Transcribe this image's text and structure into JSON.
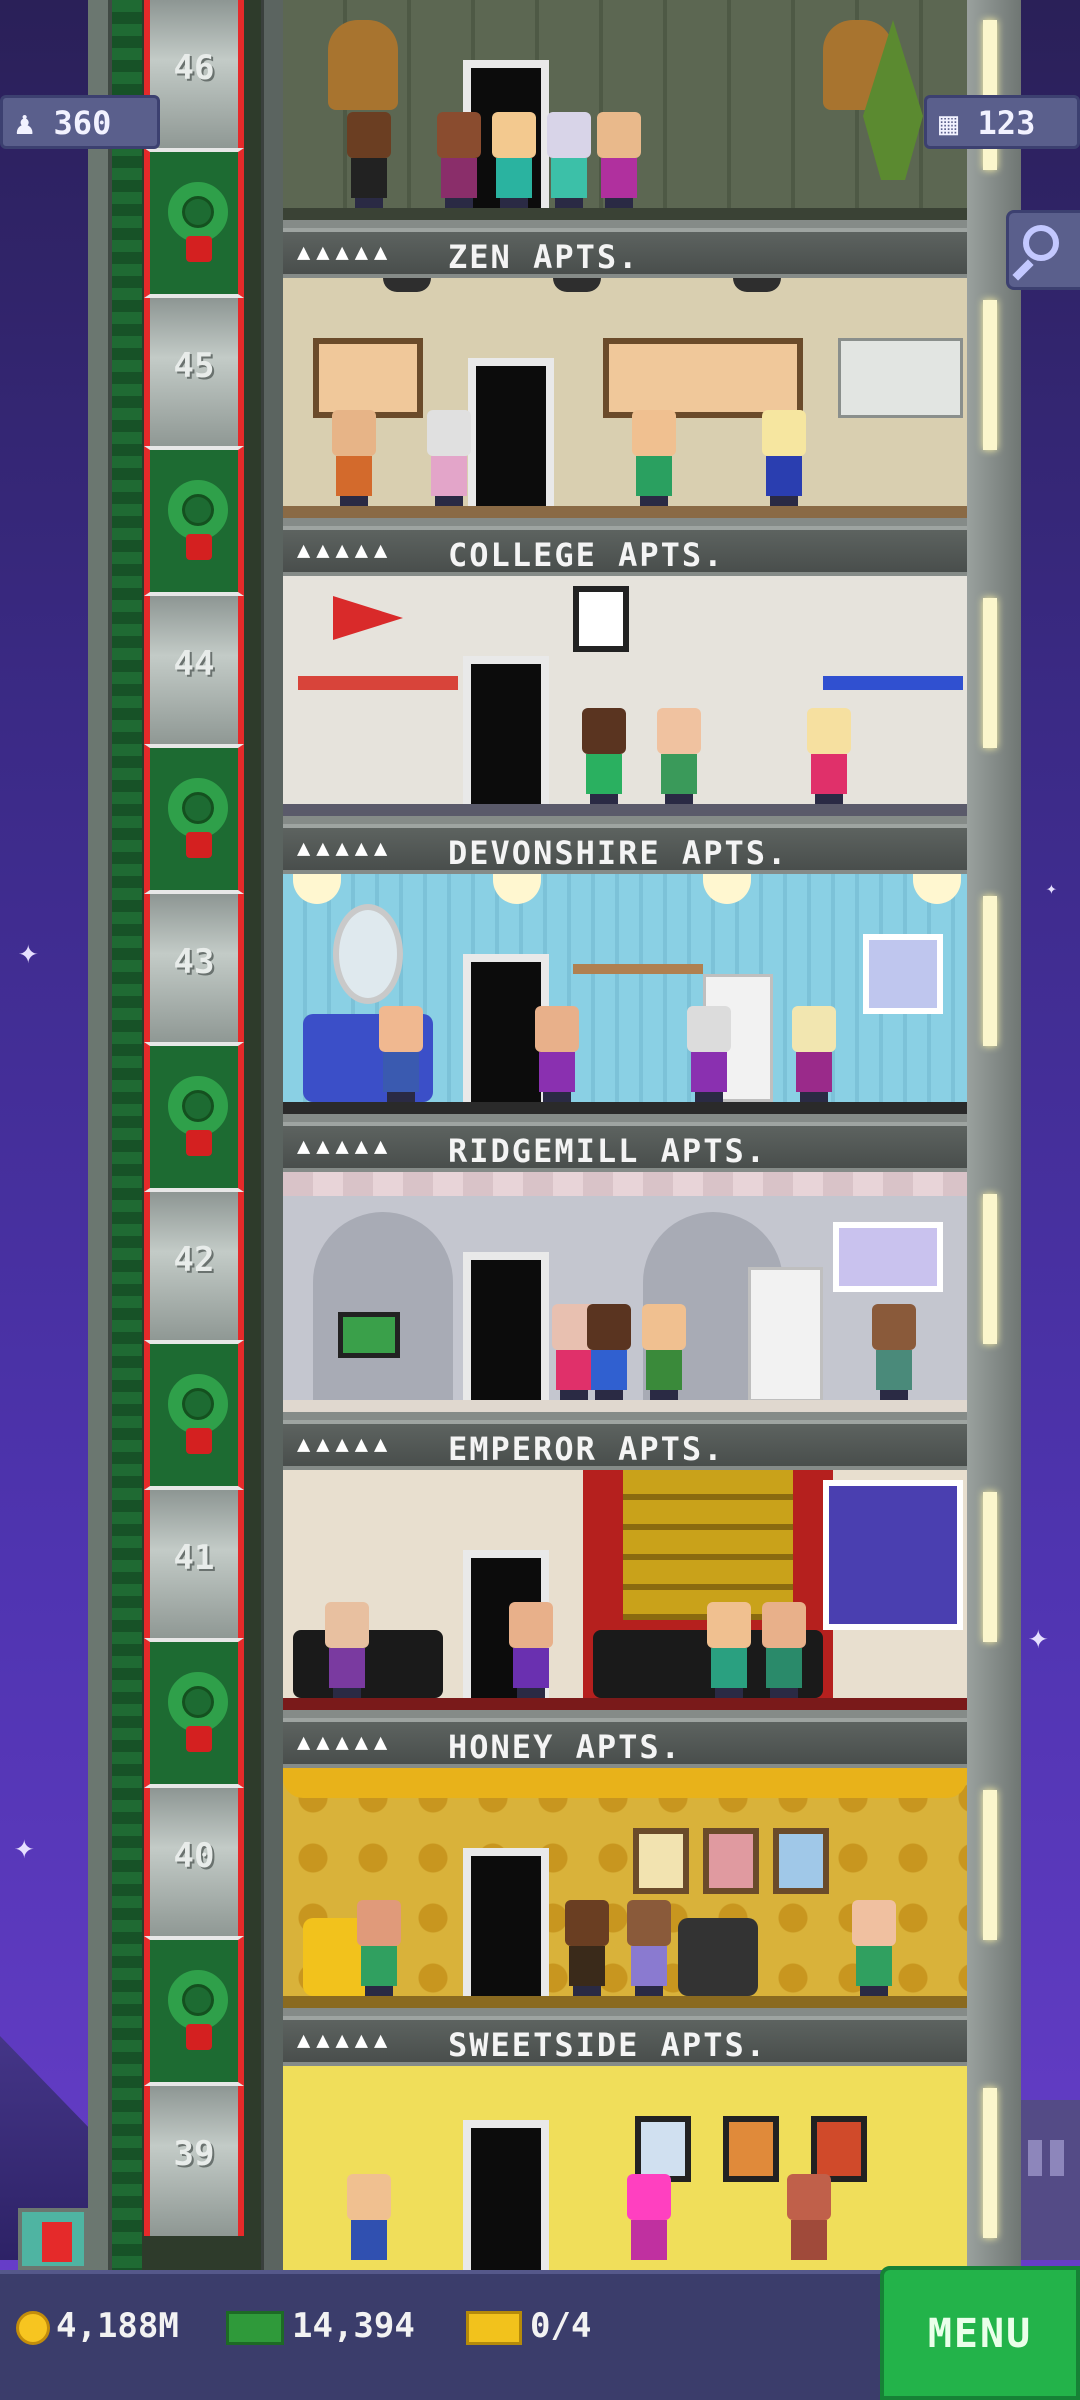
{
  "hud": {
    "population": "360",
    "floors": "123"
  },
  "bottom_bar": {
    "coins": "4,188M",
    "bux": "14,394",
    "tickets": "0/4",
    "menu_label": "MENU"
  },
  "sign_stars": "▲▲▲▲▲",
  "floors": [
    {
      "number": "46",
      "name": "ZEN APTS."
    },
    {
      "number": "45",
      "name": "COLLEGE APTS."
    },
    {
      "number": "44",
      "name": "DEVONSHIRE APTS."
    },
    {
      "number": "43",
      "name": "RIDGEMILL APTS."
    },
    {
      "number": "42",
      "name": "EMPEROR APTS."
    },
    {
      "number": "41",
      "name": "HONEY APTS."
    },
    {
      "number": "40",
      "name": "SWEETSIDE APTS."
    },
    {
      "number": "39",
      "name": ""
    }
  ],
  "colors": {
    "zen_wall": "#5a6450",
    "college_wall": "#d9cfb0",
    "devonshire_wall": "#e6e3dc",
    "ridgemill_wall": "#8ad0e4",
    "emperor_wall": "#c4c6cf",
    "honey_wall": "#e8dfcf",
    "sweetside_wall": "#d9b23a",
    "floor39_wall": "#f0de5a",
    "menu_green": "#23b34a"
  },
  "icons": [
    "population-icon",
    "floors-icon",
    "search-icon",
    "coin-icon",
    "bux-icon",
    "ticket-icon",
    "wreath-icon"
  ]
}
